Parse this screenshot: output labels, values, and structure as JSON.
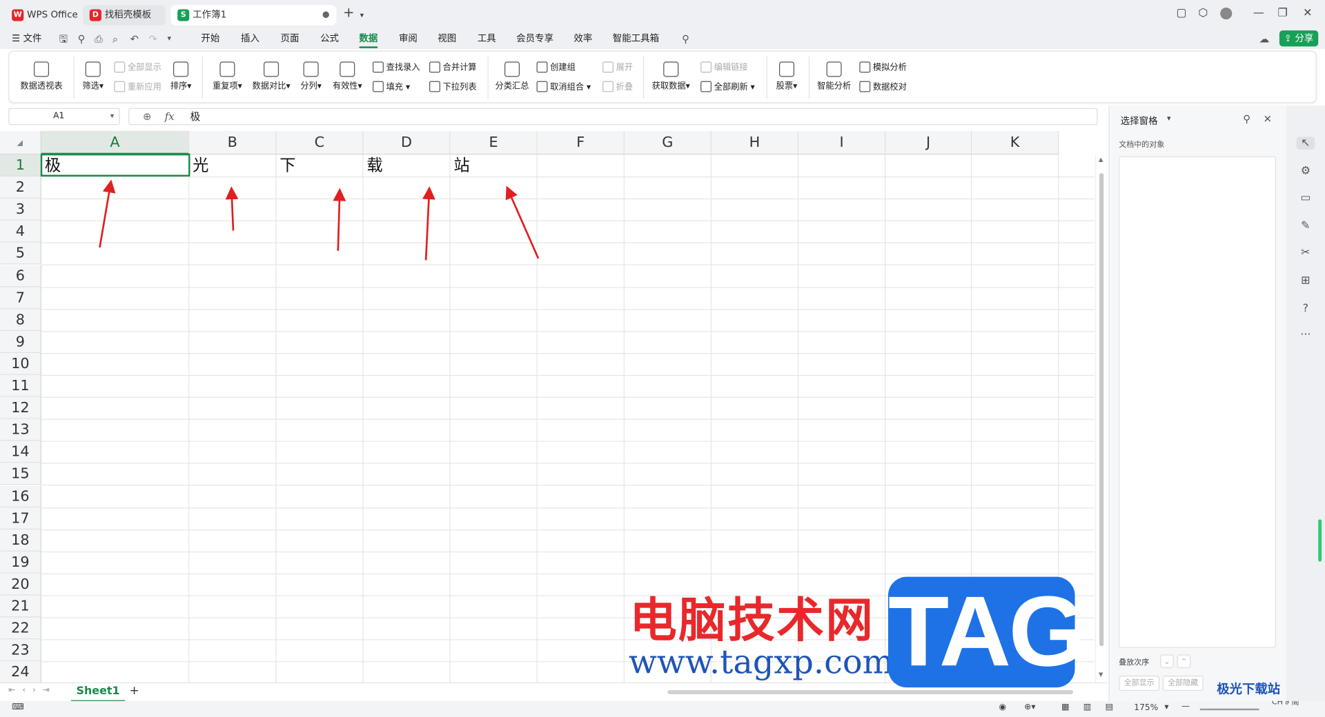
{
  "tabs": [
    {
      "label": "WPS Office",
      "icon": "wps-logo"
    },
    {
      "label": "找稻壳模板",
      "icon": "docer-icon"
    },
    {
      "label": "工作簿1",
      "icon": "spreadsheet-icon",
      "active": true
    }
  ],
  "menu": {
    "file": "文件",
    "items": [
      "开始",
      "插入",
      "页面",
      "公式",
      "数据",
      "审阅",
      "视图",
      "工具",
      "会员专享",
      "效率",
      "智能工具箱"
    ],
    "active": "数据",
    "share": "分享"
  },
  "ribbon": {
    "pivot": "数据透视表",
    "filter": "筛选",
    "show_all": "全部显示",
    "reapply": "重新应用",
    "sort": "排序",
    "duplicates": "重复项",
    "compare": "数据对比",
    "split": "分列",
    "validity": "有效性",
    "lookup": "查找录入",
    "fill": "填充",
    "merge_calc": "合并计算",
    "dropdown": "下拉列表",
    "subtotal": "分类汇总",
    "create_group": "创建组",
    "ungroup": "取消组合",
    "expand": "展开",
    "collapse": "折叠",
    "get_data": "获取数据",
    "edit_links": "编辑链接",
    "refresh_all": "全部刷新",
    "stocks": "股票",
    "smart_analysis": "智能分析",
    "simulate": "模拟分析",
    "verify": "数据校对"
  },
  "formula": {
    "cell_ref": "A1",
    "fx": "fx",
    "value": "极"
  },
  "grid": {
    "columns": [
      "A",
      "B",
      "C",
      "D",
      "E",
      "F",
      "G",
      "H",
      "I",
      "J",
      "K"
    ],
    "rows": [
      "1",
      "2",
      "3",
      "4",
      "5",
      "6",
      "7",
      "8",
      "9",
      "10",
      "11",
      "12",
      "13",
      "14",
      "15",
      "16",
      "17",
      "18",
      "19",
      "20",
      "21",
      "22",
      "23",
      "24"
    ],
    "row1": [
      "极",
      "光",
      "下",
      "载",
      "站"
    ],
    "selected": "A1"
  },
  "sheet": {
    "name": "Sheet1",
    "add": "+"
  },
  "status": {
    "zoom": "175%",
    "ime": "CH ∂ 简"
  },
  "panel": {
    "title": "选择窗格",
    "subtitle": "文档中的对象",
    "order_label": "叠放次序",
    "show_all": "全部显示",
    "hide_all": "全部隐藏"
  },
  "watermark": {
    "cn": "电脑技术网",
    "url": "www.tagxp.com",
    "tag": "TAG",
    "logo": "极光下载站"
  },
  "colors": {
    "accent": "#1a8a4a",
    "arrow": "#e02020",
    "tag_bg": "#1e72e6",
    "wm_red": "#e8282b"
  }
}
